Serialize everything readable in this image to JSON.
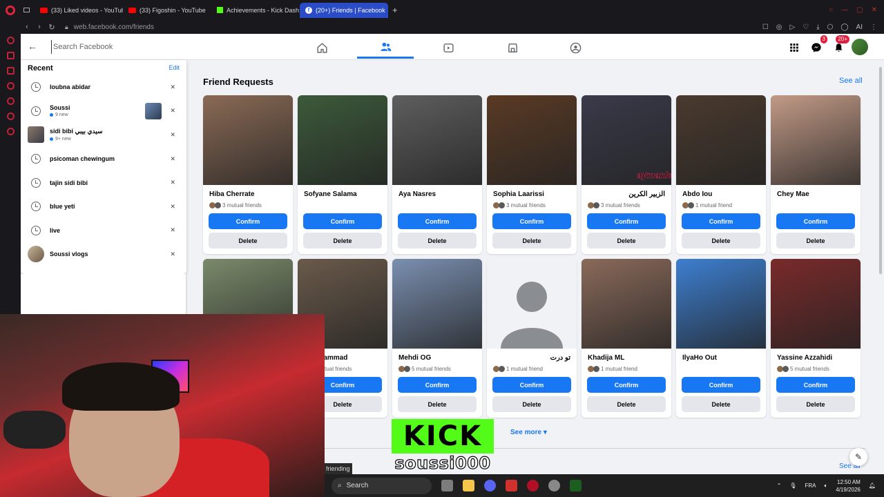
{
  "browser": {
    "tabs": [
      {
        "label": "",
        "favicon": "toggle-icon"
      },
      {
        "label": "(33) Liked videos - YouTub",
        "favicon": "youtube-icon"
      },
      {
        "label": "(33) Figoshin - YouTube",
        "favicon": "youtube-icon"
      },
      {
        "label": "Achievements - Kick Dash",
        "favicon": "kick-icon"
      },
      {
        "label": "(20+) Friends | Facebook",
        "favicon": "facebook-icon",
        "active": true
      }
    ],
    "url": "web.facebook.com/friends"
  },
  "facebook": {
    "search_placeholder": "Search Facebook",
    "badges": {
      "messenger": "3",
      "notifications": "20+"
    },
    "recent": {
      "title": "Recent",
      "edit_label": "Edit",
      "items": [
        {
          "name": "loubna abidar",
          "sub": "",
          "type": "history"
        },
        {
          "name": "Soussi",
          "sub": "9 new",
          "type": "history"
        },
        {
          "name": "sidi bibi سيدي بيبي",
          "sub": "9+ new",
          "type": "thumb"
        },
        {
          "name": "psicoman chewingum",
          "sub": "",
          "type": "history"
        },
        {
          "name": "tajin sidi bibi",
          "sub": "",
          "type": "history"
        },
        {
          "name": "blue yeti",
          "sub": "",
          "type": "history"
        },
        {
          "name": "live",
          "sub": "",
          "type": "history"
        },
        {
          "name": "Soussi vlogs",
          "sub": "",
          "type": "thumb"
        }
      ]
    },
    "friend_requests": {
      "title": "Friend Requests",
      "see_all": "See all",
      "confirm_label": "Confirm",
      "delete_label": "Delete",
      "cards": [
        {
          "name": "Hiba Cherrate",
          "mutual": "3 mutual friends",
          "color": "#8a6a55"
        },
        {
          "name": "Sofyane Salama",
          "mutual": "",
          "color": "#3c5a3a"
        },
        {
          "name": "Aya Nasres",
          "mutual": "",
          "color": "#5e5e5e"
        },
        {
          "name": "Sophia Laarissi",
          "mutual": "3 mutual friends",
          "color": "#5a3a24"
        },
        {
          "name": "الزبير الكرين",
          "mutual": "3 mutual friends",
          "color": "#3a3a4a",
          "rtl": true
        },
        {
          "name": "Abdo Iou",
          "mutual": "1 mutual friend",
          "color": "#4a3a2e"
        },
        {
          "name": "Chey Mae",
          "mutual": "",
          "color": "#c29a86"
        },
        {
          "name": "",
          "mutual": "",
          "color": "#7a8a6a"
        },
        {
          "name": "ane Mammad",
          "mutual": "mutual friends",
          "color": "#6a5a4a"
        },
        {
          "name": "Mehdi OG",
          "mutual": "5 mutual friends",
          "color": "#7a8fb0"
        },
        {
          "name": "تو درت",
          "mutual": "1 mutual friend",
          "color": "#f0f2f5",
          "rtl": true,
          "placeholder": true
        },
        {
          "name": "Khadija ML",
          "mutual": "1 mutual friend",
          "color": "#8a6a5a"
        },
        {
          "name": "IlyaHo Out",
          "mutual": "",
          "color": "#3d7fd0"
        },
        {
          "name": "Yassine Azzahidi",
          "mutual": "5 mutual friends",
          "color": "#7a2a2a"
        }
      ],
      "watermark": "aymanleboss14"
    },
    "see_more": "See more",
    "see_all_2": "See all",
    "friending_label": "friending"
  },
  "overlay": {
    "kick_logo": "KICK",
    "kick_user": "soussi000"
  },
  "taskbar": {
    "search_label": "Search",
    "language": "FRA",
    "time": "12:50 AM",
    "date": "4/19/2026"
  }
}
